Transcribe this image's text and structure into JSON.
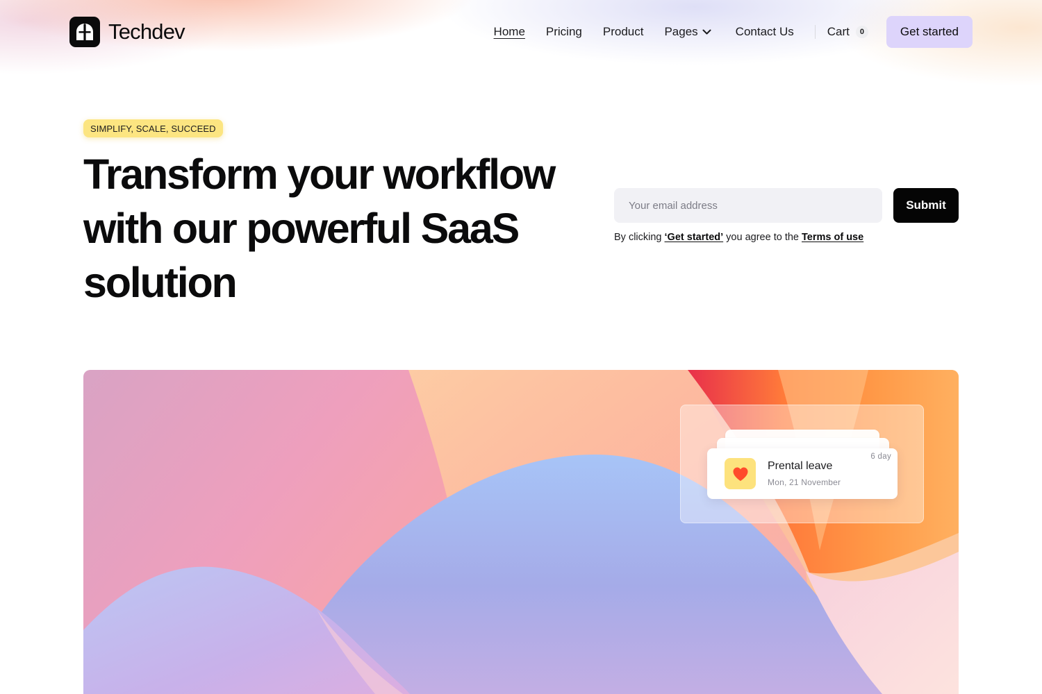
{
  "brand": {
    "name": "Techdev",
    "logo_icon": "techdev-logo-icon"
  },
  "nav": {
    "links": [
      {
        "label": "Home",
        "active": true
      },
      {
        "label": "Pricing",
        "active": false
      },
      {
        "label": "Product",
        "active": false
      },
      {
        "label": "Pages",
        "active": false,
        "icon": "chevron-down-icon"
      },
      {
        "label": "Contact Us",
        "active": false
      }
    ],
    "cart": {
      "label": "Cart",
      "count": "0"
    },
    "cta_label": "Get started",
    "cta_color": "#ddd4fb"
  },
  "hero": {
    "badge": "SIMPLIFY, SCALE, SUCCEED",
    "badge_color": "#fce581",
    "headline": "Transform your workflow with our powerful SaaS solution",
    "email_placeholder": "Your email address",
    "email_value": "",
    "submit_label": "Submit",
    "consent": {
      "prefix": "By clicking",
      "link_quote": "‘Get started’",
      "middle": "you agree to the",
      "terms_link": "Terms of use"
    }
  },
  "notification_card": {
    "title": "Prental leave",
    "date": "Mon, 21 November",
    "duration": "6 day",
    "icon": "heart-icon",
    "icon_bg": "#fde27d"
  }
}
